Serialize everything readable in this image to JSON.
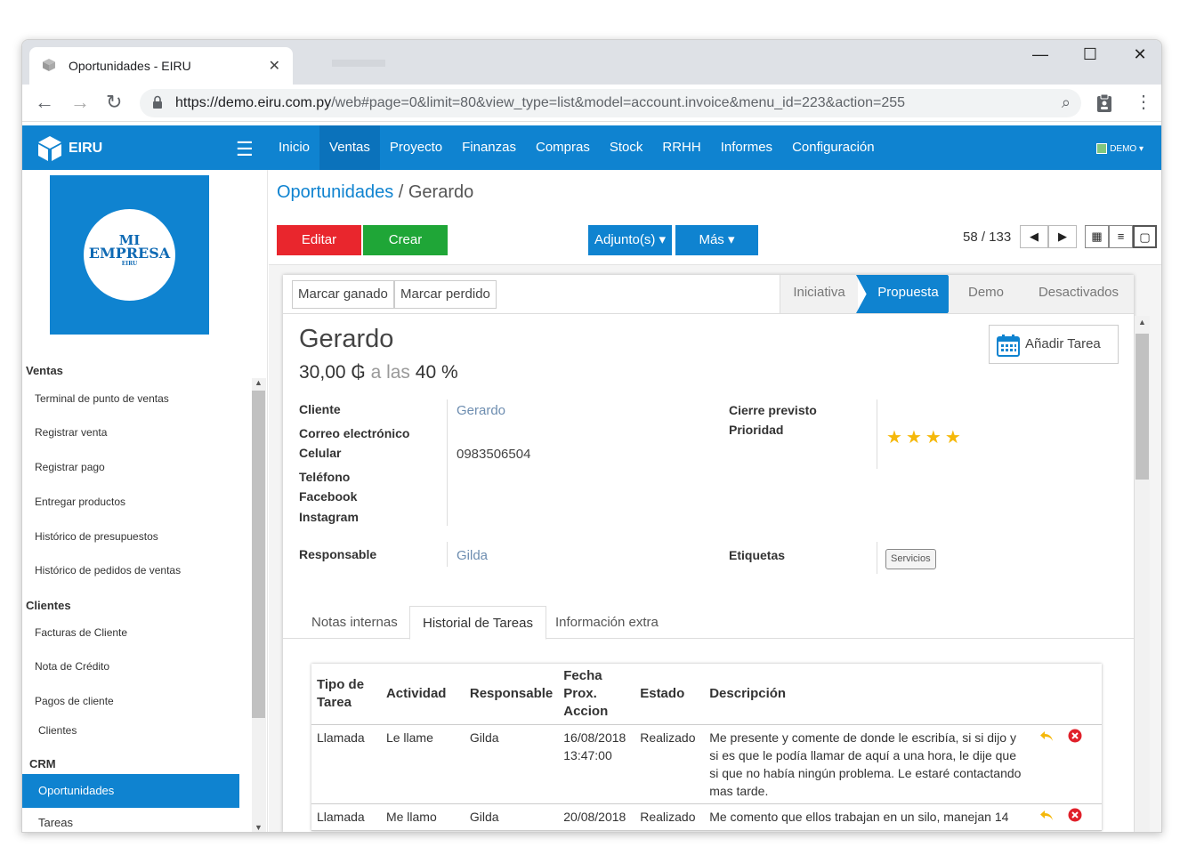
{
  "browser": {
    "tab_title": "Oportunidades - EIRU",
    "tab_close": "✕",
    "url_host": "https://demo.eiru.com.py",
    "url_path": "/web#page=0&limit=80&view_type=list&model=account.invoice&menu_id=223&action=255",
    "minimize": "—",
    "maximize": "☐",
    "close": "✕"
  },
  "header": {
    "brand": "EIRU",
    "menu": [
      "Inicio",
      "Ventas",
      "Proyecto",
      "Finanzas",
      "Compras",
      "Stock",
      "RRHH",
      "Informes",
      "Configuración"
    ],
    "active_menu": "Ventas",
    "user": "DEMO ▾"
  },
  "sidebar": {
    "logo": {
      "line1": "MI",
      "line2": "EMPRESA",
      "line3": "EIRU"
    },
    "sections": [
      {
        "title": "Ventas",
        "items": [
          "Terminal de punto de ventas",
          "Registrar venta",
          "Registrar pago",
          "Entregar productos",
          "Histórico de presupuestos",
          "Histórico de pedidos de ventas"
        ]
      },
      {
        "title": "Clientes",
        "items": [
          "Facturas de Cliente",
          "Nota de Crédito",
          "Pagos de cliente",
          "Clientes"
        ]
      },
      {
        "title": "CRM",
        "items": [
          "Oportunidades",
          "Tareas"
        ]
      }
    ],
    "active_item": "Oportunidades"
  },
  "main": {
    "breadcrumb_link": "Oportunidades",
    "breadcrumb_sep": " / ",
    "breadcrumb_current": "Gerardo",
    "buttons": {
      "edit": "Editar",
      "create": "Crear",
      "attachments": "Adjunto(s) ▾",
      "more": "Más ▾"
    },
    "pager": "58 / 133",
    "status_buttons": {
      "won": "Marcar ganado",
      "lost": "Marcar perdido"
    },
    "stages": [
      "Iniciativa",
      "Propuesta",
      "Demo",
      "Desactivados"
    ],
    "active_stage": "Propuesta",
    "record": {
      "name": "Gerardo",
      "amount": "30,00 ₲",
      "amount_sep": " a las ",
      "probability": "40 %",
      "add_task": "Añadir Tarea"
    },
    "fields": {
      "cliente_label": "Cliente",
      "cliente_value": "Gerardo",
      "correo_label": "Correo electrónico",
      "celular_label": "Celular",
      "celular_value": "0983506504",
      "telefono_label": "Teléfono",
      "facebook_label": "Facebook",
      "instagram_label": "Instagram",
      "responsable_label": "Responsable",
      "responsable_value": "Gilda",
      "cierre_label": "Cierre previsto",
      "prioridad_label": "Prioridad",
      "priority_stars": 4,
      "etiquetas_label": "Etiquetas",
      "tag": "Servicios"
    },
    "tabs": [
      "Notas internas",
      "Historial de Tareas",
      "Información extra"
    ],
    "active_tab": "Historial de Tareas",
    "task_table": {
      "headers": [
        "Tipo de Tarea",
        "Actividad",
        "Responsable",
        "Fecha Prox. Accion",
        "Estado",
        "Descripción"
      ],
      "rows": [
        [
          "Llamada",
          "Le llame",
          "Gilda",
          "16/08/2018 13:47:00",
          "Realizado",
          "Me presente y comente de donde le escribía, si si dijo y si es que le podía llamar de aquí a una hora, le dije que si que no había ningún problema. Le estaré contactando mas tarde."
        ],
        [
          "Llamada",
          "Me llamo",
          "Gilda",
          "20/08/2018",
          "Realizado",
          "Me comento que ellos trabajan en un silo, manejan 14"
        ]
      ]
    }
  },
  "colors": {
    "primary": "#0f83d0",
    "edit": "#e9262d",
    "create": "#1fa637",
    "star": "#f5b80a"
  }
}
